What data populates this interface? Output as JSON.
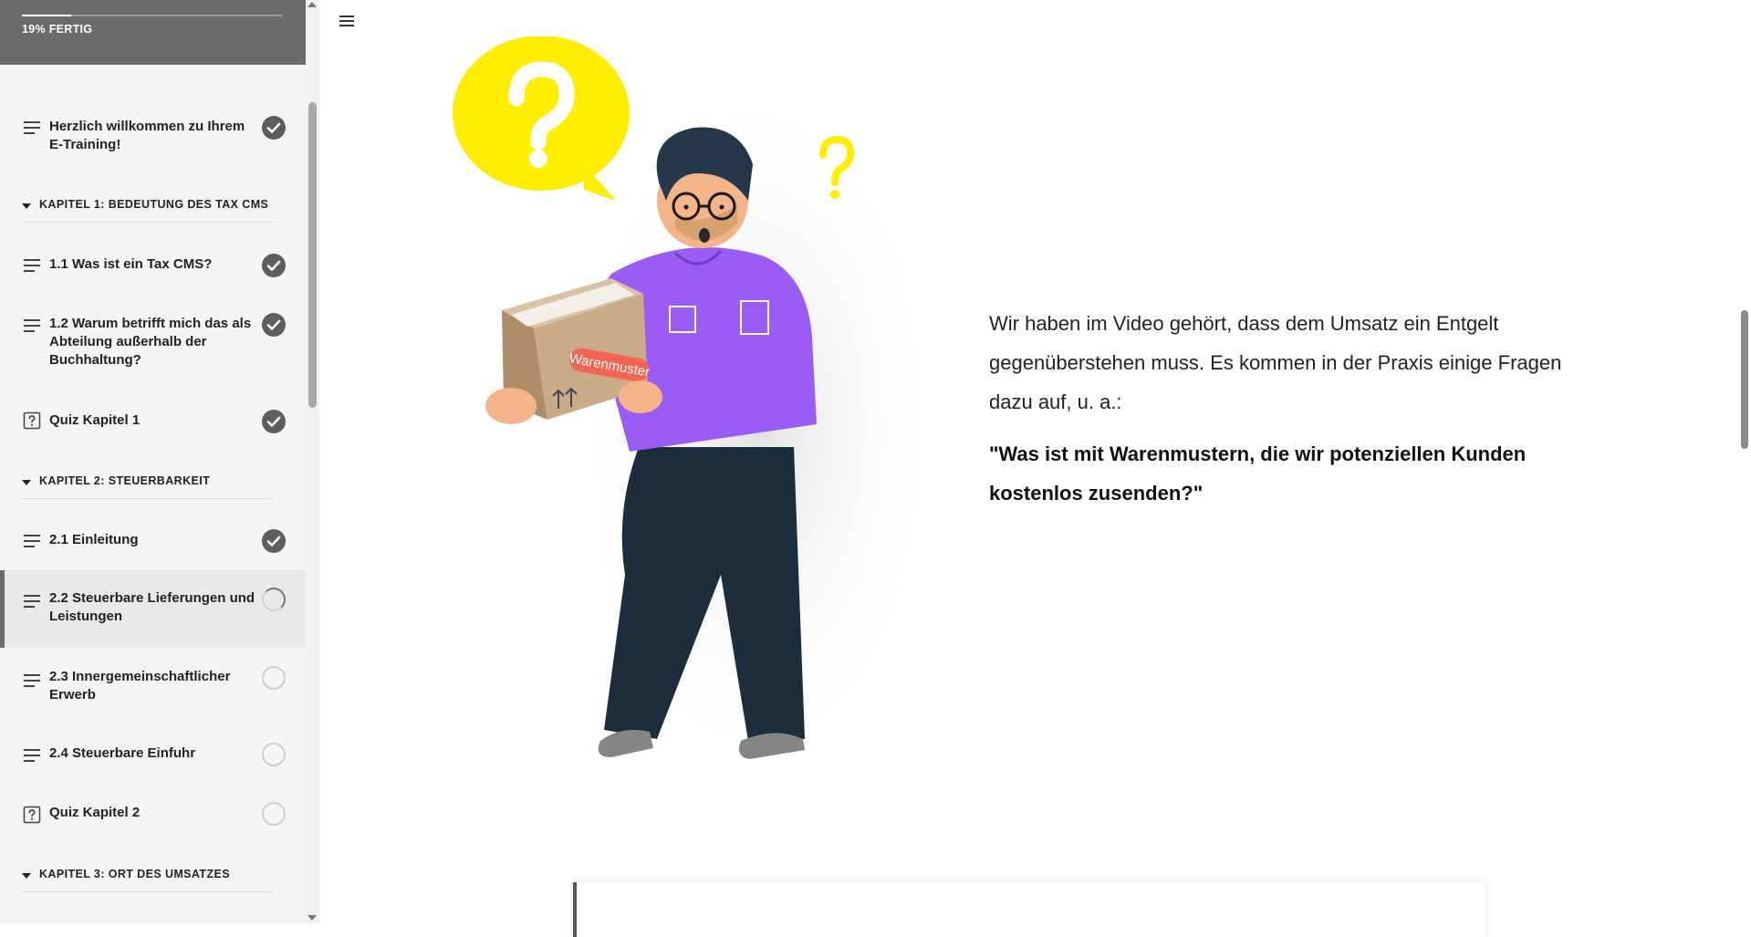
{
  "progress": {
    "label": "19% FERTIG",
    "fraction": 0.19
  },
  "sidebar": {
    "items": [
      {
        "kind": "lesson",
        "icon": "text-lines-icon",
        "label": "Herzlich willkommen zu Ihrem E-Training!",
        "status": "done"
      },
      {
        "kind": "chapter",
        "label": "KAPITEL 1: BEDEUTUNG DES TAX CMS"
      },
      {
        "kind": "lesson",
        "icon": "text-lines-icon",
        "label": "1.1 Was ist ein Tax CMS?",
        "status": "done"
      },
      {
        "kind": "lesson",
        "icon": "text-lines-icon",
        "label": "1.2 Warum betrifft mich das als Abteilung außerhalb der Buchhaltung?",
        "status": "done"
      },
      {
        "kind": "lesson",
        "icon": "quiz-icon",
        "label": "Quiz Kapitel 1",
        "status": "done"
      },
      {
        "kind": "chapter",
        "label": "KAPITEL 2: STEUERBARKEIT"
      },
      {
        "kind": "lesson",
        "icon": "text-lines-icon",
        "label": "2.1 Einleitung",
        "status": "done"
      },
      {
        "kind": "lesson",
        "icon": "text-lines-icon",
        "label": "2.2 Steuerbare Lieferungen und Leistungen",
        "status": "in-progress",
        "active": true
      },
      {
        "kind": "lesson",
        "icon": "text-lines-icon",
        "label": "2.3 Innergemeinschaftlicher Erwerb",
        "status": "not-started"
      },
      {
        "kind": "lesson",
        "icon": "text-lines-icon",
        "label": "2.4 Steuerbare Einfuhr",
        "status": "not-started"
      },
      {
        "kind": "lesson",
        "icon": "quiz-icon",
        "label": "Quiz Kapitel 2",
        "status": "not-started"
      },
      {
        "kind": "chapter",
        "label": "KAPITEL 3: ORT DES UMSATZES"
      }
    ]
  },
  "main": {
    "illustration": {
      "box_label": "Warenmuster"
    },
    "lead_text": "Wir haben im Video gehört, dass dem Umsatz ein Entgelt gegenüberstehen muss. Es kommen in der Praxis einige Fragen dazu auf, u. a.:",
    "question_text": "\"Was ist mit Warenmustern, die wir potenziellen Kunden kostenlos zusenden?\""
  },
  "colors": {
    "sidebar_header": "#6b6b6b",
    "status_done": "#5e5e5e",
    "accent_yellow": "#ffee00",
    "shirt_purple": "#9b5cf6",
    "tag_red": "#f26454"
  }
}
